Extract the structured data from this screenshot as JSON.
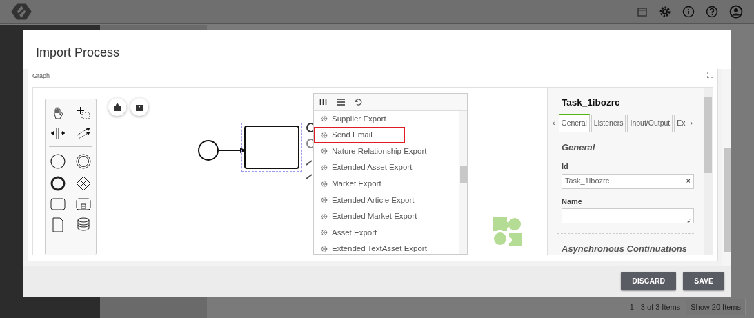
{
  "modal": {
    "title": "Import Process",
    "graph_label": "Graph",
    "element_list": {
      "items": [
        {
          "label": "Supplier Export",
          "highlighted": false
        },
        {
          "label": "Send Email",
          "highlighted": true
        },
        {
          "label": "Nature Relationship Export",
          "highlighted": false
        },
        {
          "label": "Extended Asset Export",
          "highlighted": false
        },
        {
          "label": "Market Export",
          "highlighted": false
        },
        {
          "label": "Extended Article Export",
          "highlighted": false
        },
        {
          "label": "Extended Market Export",
          "highlighted": false
        },
        {
          "label": "Asset Export",
          "highlighted": false
        },
        {
          "label": "Extended TextAsset Export",
          "highlighted": false
        }
      ]
    },
    "properties": {
      "title": "Task_1ibozrc",
      "tab_prev": "‹",
      "tab_next": "›",
      "tabs": [
        {
          "label": "General",
          "selected": true
        },
        {
          "label": "Listeners",
          "selected": false
        },
        {
          "label": "Input/Output",
          "selected": false
        },
        {
          "label": "Ex",
          "selected": false
        }
      ],
      "section": "General",
      "fields": [
        {
          "kind": "text",
          "label": "Id",
          "value": "Task_1ibozrc",
          "clear_symbol": "×"
        },
        {
          "kind": "textarea",
          "label": "Name"
        }
      ],
      "next_section": "Asynchronous Continuations"
    },
    "buttons": [
      {
        "label": "DISCARD"
      },
      {
        "label": "SAVE"
      }
    ]
  },
  "pager": {
    "range": "1 - 3 of 3 Items",
    "page_size": "Show 20 Items"
  }
}
